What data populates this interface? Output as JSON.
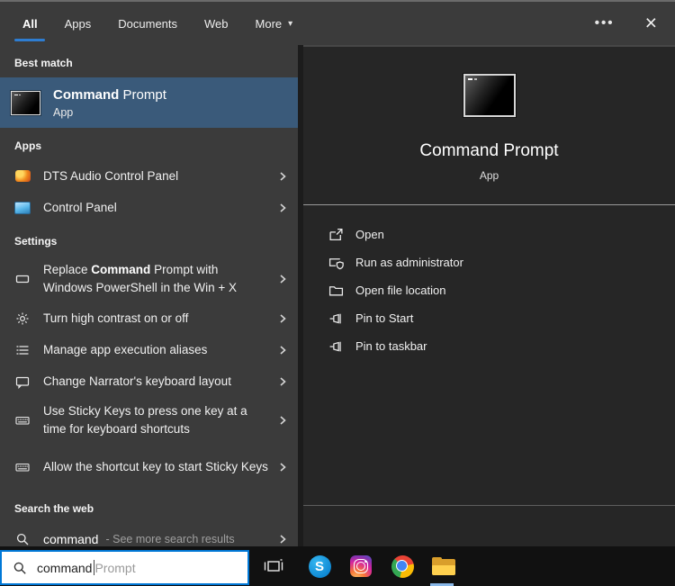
{
  "tabs": {
    "items": [
      {
        "label": "All",
        "active": true
      },
      {
        "label": "Apps",
        "active": false
      },
      {
        "label": "Documents",
        "active": false
      },
      {
        "label": "Web",
        "active": false
      },
      {
        "label": "More",
        "active": false
      }
    ],
    "more_caret": "▾",
    "ellipsis": "•••",
    "close": "×"
  },
  "left": {
    "best_match": {
      "header": "Best match",
      "title_bold": "Command",
      "title_rest": " Prompt",
      "subtitle": "App",
      "icon": "command-prompt-icon"
    },
    "apps": {
      "header": "Apps",
      "items": [
        {
          "label": "DTS Audio Control Panel",
          "icon": "dts-audio-icon"
        },
        {
          "label": "Control Panel",
          "icon": "control-panel-icon"
        }
      ]
    },
    "settings": {
      "header": "Settings",
      "items": [
        {
          "pre": "Replace ",
          "bold": "Command",
          "post": " Prompt with Windows PowerShell in the Win + X",
          "icon": "display-icon"
        },
        {
          "label": "Turn high contrast on or off",
          "icon": "high-contrast-sun-icon"
        },
        {
          "label": "Manage app execution aliases",
          "icon": "list-icon"
        },
        {
          "label": "Change Narrator's keyboard layout",
          "icon": "narrator-icon"
        },
        {
          "label": "Use Sticky Keys to press one key at a time for keyboard shortcuts",
          "icon": "keyboard-icon"
        },
        {
          "label": "Allow the shortcut key to start Sticky Keys",
          "icon": "keyboard-icon"
        }
      ]
    },
    "web": {
      "header": "Search the web",
      "query": "command",
      "hint": "- See more search results",
      "icon": "search-icon"
    }
  },
  "preview": {
    "title": "Command Prompt",
    "subtitle": "App",
    "icon": "command-prompt-icon-large",
    "actions": [
      {
        "label": "Open",
        "icon": "open-window-icon"
      },
      {
        "label": "Run as administrator",
        "icon": "admin-shield-icon"
      },
      {
        "label": "Open file location",
        "icon": "folder-icon"
      },
      {
        "label": "Pin to Start",
        "icon": "pin-icon"
      },
      {
        "label": "Pin to taskbar",
        "icon": "pin-icon"
      }
    ]
  },
  "taskbar": {
    "search_value": "command",
    "search_suggestion": "Prompt",
    "skype_letter": "S",
    "icons": [
      "task-view",
      "skype",
      "instagram",
      "chrome",
      "file-explorer"
    ]
  },
  "colors": {
    "accent": "#0078d7",
    "selection_blue": "#3a5a7a",
    "tab_underline": "#2e7dd1",
    "left_pane_bg": "#3b3b3b",
    "right_pane_bg": "#262626",
    "taskbar_bg": "#111111",
    "taskbar_indicator": "#8ab8e8"
  }
}
